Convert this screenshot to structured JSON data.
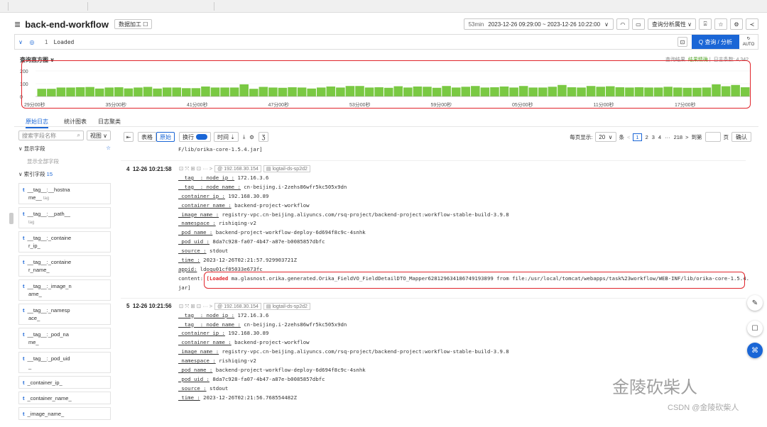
{
  "header": {
    "title": "back-end-workflow",
    "data_process_btn": "数据加工 ☐",
    "duration_badge": "53min",
    "time_range": "2023-12-26 09:29:00 ~ 2023-12-26 10:22:00",
    "analysis_attr": "查询分析属性"
  },
  "query": {
    "line_no": "1",
    "text": "Loaded",
    "search_btn": "Q 查询 / 分析",
    "auto_label": "AUTO"
  },
  "histogram": {
    "title": "查询直方图 ∨",
    "status_text": "查询结果",
    "accurate_text": "结果精确",
    "count_label": "日志条数: 4,342",
    "y_ticks": [
      "200",
      "100",
      "0"
    ],
    "x_ticks": [
      "29分00秒",
      "35分00秒",
      "41分00秒",
      "47分00秒",
      "53分00秒",
      "59分00秒",
      "05分00秒",
      "11分00秒",
      "17分00秒"
    ],
    "bar_color": "#7ac943"
  },
  "chart_data": {
    "type": "bar",
    "title": "",
    "ylim": [
      0,
      200
    ],
    "values": [
      60,
      60,
      70,
      70,
      72,
      74,
      62,
      70,
      72,
      63,
      70,
      75,
      62,
      70,
      70,
      65,
      65,
      78,
      70,
      70,
      70,
      95,
      60,
      75,
      70,
      68,
      72,
      70,
      62,
      70,
      78,
      70,
      82,
      82,
      70,
      72,
      68,
      80,
      70,
      78,
      76,
      68,
      82,
      70,
      76,
      82,
      70,
      72,
      78,
      70,
      82,
      70,
      70,
      76,
      90,
      72,
      70,
      82,
      76,
      80,
      72,
      70,
      72,
      70,
      70,
      76,
      70,
      68,
      68,
      70,
      95,
      80,
      90,
      72
    ]
  },
  "tabs": {
    "raw": "原始日志",
    "stats": "统计图表",
    "cluster": "日志聚类"
  },
  "left": {
    "search_placeholder": "搜索字段名称",
    "view_btn": "视图 ∨",
    "display_fields": "∨  显示字段",
    "show_all": "显示全部字段",
    "index_fields": "∨  索引字段",
    "index_count": "15",
    "fields": [
      {
        "type": "t",
        "name": "__tag__:__hostna",
        "sub": "me__",
        "badge": "tag"
      },
      {
        "type": "t",
        "name": "__tag__:__path__",
        "sub": "",
        "badge": "tag"
      },
      {
        "type": "t",
        "name": "__tag__:_containe",
        "sub": "r_ip_",
        "badge": ""
      },
      {
        "type": "t",
        "name": "__tag__:_containe",
        "sub": "r_name_",
        "badge": ""
      },
      {
        "type": "t",
        "name": "__tag__:_image_n",
        "sub": "ame_",
        "badge": ""
      },
      {
        "type": "t",
        "name": "__tag__:_namesp",
        "sub": "ace_",
        "badge": ""
      },
      {
        "type": "t",
        "name": "__tag__:_pod_na",
        "sub": "me_",
        "badge": ""
      },
      {
        "type": "t",
        "name": "__tag__:_pod_uid",
        "sub": "_",
        "badge": ""
      },
      {
        "type": "t",
        "name": "_container_ip_",
        "sub": "",
        "badge": ""
      },
      {
        "type": "t",
        "name": "_container_name_",
        "sub": "",
        "badge": ""
      },
      {
        "type": "t",
        "name": "_image_name_",
        "sub": "",
        "badge": ""
      }
    ]
  },
  "toolbar": {
    "table": "表格",
    "raw": "原始",
    "wrap": "换行",
    "time": "时间 ⇣",
    "per_page_label": "每页显示:",
    "per_page": "20",
    "unit": "条",
    "pages": [
      "1",
      "2",
      "3",
      "4",
      "···",
      "218"
    ],
    "goto": "到第",
    "page_unit": "页",
    "confirm": "确认"
  },
  "prev_tail": "F/lib/orika-core-1.5.4.jar]",
  "records": [
    {
      "idx": "4",
      "time": "12-26 10:21:58",
      "ip": "192.168.30.154",
      "store": "logtail-ds-sp2d2",
      "lines": [
        [
          "__tag__:_node_ip_:",
          "172.16.3.6"
        ],
        [
          "__tag__:_node_name_:",
          "cn-beijing.i-2zehs86wfr5kc505x9dn"
        ],
        [
          "_container_ip_:",
          "192.168.30.89"
        ],
        [
          "_container_name_:",
          "backend-project-workflow"
        ],
        [
          "_image_name_:",
          "registry-vpc.cn-beijing.aliyuncs.com/rsq-project/backend-project:workflow-stable-build-3.9.8"
        ],
        [
          "_namespace_:",
          "rishiqing-v2"
        ],
        [
          "_pod_name_:",
          "backend-project-workflow-deploy-6d694f8c9c-4snhk"
        ],
        [
          "_pod_uid_:",
          "8da7c928-fa07-4b47-a87e-b0085857dbfc"
        ],
        [
          "_source_:",
          "stdout"
        ],
        [
          "_time_:",
          "2023-12-26T02:21:57.929903721Z"
        ],
        [
          "appid:",
          "ldoqu01cf05033e673fc"
        ]
      ],
      "content_key": "content:",
      "content_hl": "[Loaded",
      "content_rest": " ma.glasnost.orika.generated.Orika_FieldVO_FieldDetailDTO_Mapper628129634186749193899 from file:/usr/local/tomcat/webapps/task%23workflow/WEB-INF/lib/orika-core-1.5.4.",
      "content_tail": "jar]"
    },
    {
      "idx": "5",
      "time": "12-26 10:21:56",
      "ip": "192.168.30.154",
      "store": "logtail-ds-sp2d2",
      "lines": [
        [
          "__tag__:_node_ip_:",
          "172.16.3.6"
        ],
        [
          "__tag__:_node_name_:",
          "cn-beijing.i-2zehs86wfr5kc505x9dn"
        ],
        [
          "_container_ip_:",
          "192.168.30.89"
        ],
        [
          "_container_name_:",
          "backend-project-workflow"
        ],
        [
          "_image_name_:",
          "registry-vpc.cn-beijing.aliyuncs.com/rsq-project/backend-project:workflow-stable-build-3.9.8"
        ],
        [
          "_namespace_:",
          "rishiqing-v2"
        ],
        [
          "_pod_name_:",
          "backend-project-workflow-deploy-6d694f8c9c-4snhk"
        ],
        [
          "_pod_uid_:",
          "8da7c928-fa07-4b47-a87e-b0085857dbfc"
        ],
        [
          "_source_:",
          "stdout"
        ],
        [
          "_time_:",
          "2023-12-26T02:21:56.768554482Z"
        ]
      ]
    }
  ],
  "watermark": {
    "main": "金陵砍柴人",
    "sub": "CSDN @金陵砍柴人"
  }
}
